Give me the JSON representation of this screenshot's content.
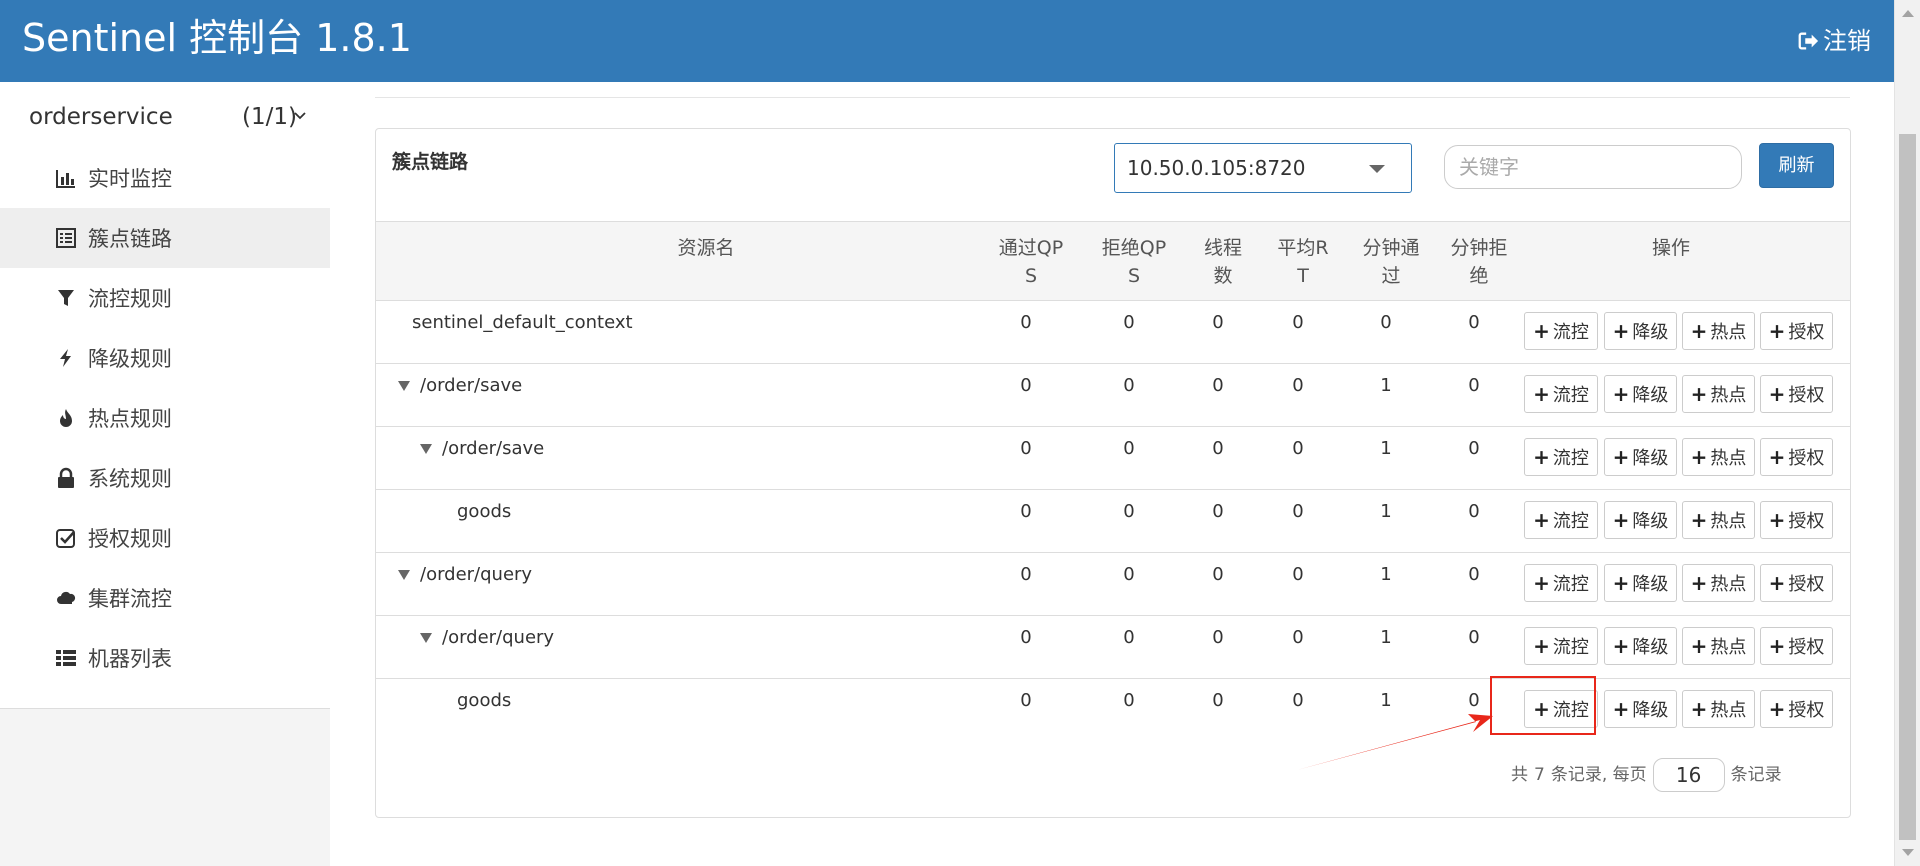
{
  "header": {
    "title": "Sentinel 控制台 1.8.1",
    "logout_label": "注销"
  },
  "sidebar": {
    "app": {
      "name": "orderservice",
      "count": "(1/1)"
    },
    "items": [
      {
        "label": "实时监控",
        "icon": "bar-chart-icon"
      },
      {
        "label": "簇点链路",
        "icon": "list-icon",
        "active": true
      },
      {
        "label": "流控规则",
        "icon": "filter-icon"
      },
      {
        "label": "降级规则",
        "icon": "flash-icon"
      },
      {
        "label": "热点规则",
        "icon": "fire-icon"
      },
      {
        "label": "系统规则",
        "icon": "lock-icon"
      },
      {
        "label": "授权规则",
        "icon": "check-square-icon"
      },
      {
        "label": "集群流控",
        "icon": "cloud-icon"
      },
      {
        "label": "机器列表",
        "icon": "th-list-icon"
      }
    ]
  },
  "panel": {
    "title": "簇点链路",
    "machine_select": "10.50.0.105:8720",
    "search_placeholder": "关键字",
    "refresh_label": "刷新"
  },
  "table": {
    "headers": {
      "resource": "资源名",
      "pass_qps": [
        "通过QP",
        "S"
      ],
      "block_qps": [
        "拒绝QP",
        "S"
      ],
      "threads": [
        "线程",
        "数"
      ],
      "avg_rt": [
        "平均R",
        "T"
      ],
      "minute_pass": [
        "分钟通",
        "过"
      ],
      "minute_block": [
        "分钟拒",
        "绝"
      ],
      "ops": "操作"
    },
    "op_labels": {
      "flow": "流控",
      "degrade": "降级",
      "hotspot": "热点",
      "authority": "授权"
    },
    "rows": [
      {
        "name": "sentinel_default_context",
        "level": 0,
        "expandable": false,
        "pass_qps": "0",
        "block_qps": "0",
        "threads": "0",
        "avg_rt": "0",
        "minute_pass": "0",
        "minute_block": "0"
      },
      {
        "name": "/order/save",
        "level": 0,
        "expandable": true,
        "pass_qps": "0",
        "block_qps": "0",
        "threads": "0",
        "avg_rt": "0",
        "minute_pass": "1",
        "minute_block": "0"
      },
      {
        "name": "/order/save",
        "level": 1,
        "expandable": true,
        "pass_qps": "0",
        "block_qps": "0",
        "threads": "0",
        "avg_rt": "0",
        "minute_pass": "1",
        "minute_block": "0"
      },
      {
        "name": "goods",
        "level": 2,
        "expandable": false,
        "pass_qps": "0",
        "block_qps": "0",
        "threads": "0",
        "avg_rt": "0",
        "minute_pass": "1",
        "minute_block": "0"
      },
      {
        "name": "/order/query",
        "level": 0,
        "expandable": true,
        "pass_qps": "0",
        "block_qps": "0",
        "threads": "0",
        "avg_rt": "0",
        "minute_pass": "1",
        "minute_block": "0"
      },
      {
        "name": "/order/query",
        "level": 1,
        "expandable": true,
        "pass_qps": "0",
        "block_qps": "0",
        "threads": "0",
        "avg_rt": "0",
        "minute_pass": "1",
        "minute_block": "0"
      },
      {
        "name": "goods",
        "level": 2,
        "expandable": false,
        "pass_qps": "0",
        "block_qps": "0",
        "threads": "0",
        "avg_rt": "0",
        "minute_pass": "1",
        "minute_block": "0"
      }
    ]
  },
  "pagination": {
    "total_prefix": "共",
    "total": "7",
    "total_suffix": "条记录, 每页",
    "page_size": "16",
    "page_suffix": "条记录"
  },
  "colors": {
    "primary": "#337ab7",
    "highlight": "#e8271a"
  }
}
